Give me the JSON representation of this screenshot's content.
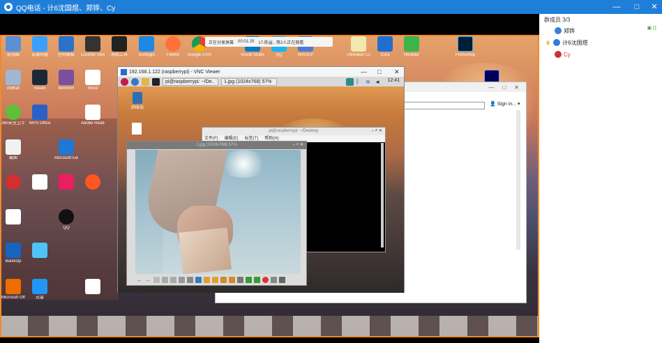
{
  "qq_window": {
    "title": "QQ电话 - 计6沈国煜、郑铧、Cy",
    "controls": [
      "—",
      "□",
      "✕"
    ]
  },
  "share_status": {
    "sharing_label": "正在分享屏幕",
    "elapsed": "00:01:29",
    "viewers": "17-陈益...等2人正在观看"
  },
  "windows_desktop_icons": [
    {
      "label": "此电脑"
    },
    {
      "label": "百度网盘"
    },
    {
      "label": "控制面板"
    },
    {
      "label": "Counter-Strike"
    },
    {
      "label": "系统工具"
    },
    {
      "label": "Sunlogin"
    },
    {
      "label": "Firefox"
    },
    {
      "label": "Google Chrome"
    },
    {
      "label": "Visual Studio Code"
    },
    {
      "label": "QQ"
    },
    {
      "label": "WinSCP"
    },
    {
      "label": "Internet Explorer"
    },
    {
      "label": "Ultimaker Cura"
    },
    {
      "label": "Cura"
    },
    {
      "label": "Hbuilder"
    },
    {
      "label": "Photoshop"
    },
    {
      "label": "回收站"
    },
    {
      "label": "Steam"
    },
    {
      "label": "WinRAR"
    },
    {
      "label": "Word"
    },
    {
      "label": "360安全卫士"
    },
    {
      "label": "WPS Office"
    },
    {
      "label": "截图"
    },
    {
      "label": "Adobe Reader"
    },
    {
      "label": "Microsoft Edge"
    },
    {
      "label": "Bandizip"
    },
    {
      "label": "QQ"
    },
    {
      "label": "Microsoft Office"
    },
    {
      "label": "迅雷"
    }
  ],
  "browser_window": {
    "sign_in": "Sign in..."
  },
  "vnc_viewer": {
    "title": "192.168.1.122 (raspberrypi) - VNC Viewer",
    "controls": [
      "—",
      "□",
      "✕"
    ]
  },
  "pi_taskbar": {
    "tasks": [
      "pi@raspberrypi: ~/De..",
      "1.jpg (1024x768) 57%"
    ],
    "clock": "12:41"
  },
  "pi_desktop": {
    "trash_label": "回收站"
  },
  "terminal": {
    "title": "pi@raspberrypi: ~/Desktop",
    "menu": [
      "文件(F)",
      "编辑(E)",
      "标签(T)",
      "帮助(H)"
    ]
  },
  "image_viewer": {
    "title": "1.jpg (1024x768) 57%"
  },
  "members_panel": {
    "header": "群成员 3/3",
    "members": [
      {
        "name": "郑铧",
        "color": "#3a7fd6"
      },
      {
        "name": "计6沈国煜",
        "color": "#e0a020"
      },
      {
        "name": "Cy",
        "color": "#cc3333"
      }
    ]
  },
  "colors": {
    "qq_blue": "#1f7fd8",
    "share_frame": "#f08a2a"
  }
}
